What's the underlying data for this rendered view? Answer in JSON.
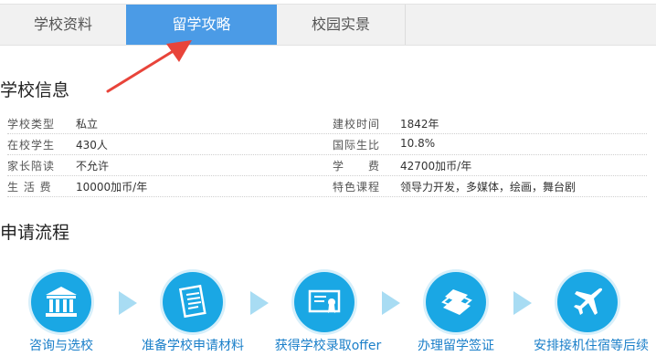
{
  "tabs": [
    {
      "label": "学校资料",
      "active": false
    },
    {
      "label": "留学攻略",
      "active": true
    },
    {
      "label": "校园实景",
      "active": false
    }
  ],
  "school_info": {
    "title": "学校信息",
    "rows": [
      {
        "l1": "学校类型",
        "v1": "私立",
        "l2": "建校时间",
        "v2": "1842年"
      },
      {
        "l1": "在校学生",
        "v1": "430人",
        "l2": "国际生比",
        "v2": "10.8%"
      },
      {
        "l1": "家长陪读",
        "v1": "不允许",
        "l2": "学　　费",
        "v2": "42700加币/年"
      },
      {
        "l1": "生 活 费",
        "v1": "10000加币/年",
        "l2": "特色课程",
        "v2": "领导力开发，多媒体，绘画，舞台剧"
      }
    ]
  },
  "process": {
    "title": "申请流程",
    "steps": [
      {
        "label": "咨询与选校",
        "icon": "institution-icon"
      },
      {
        "label": "准备学校申请材料",
        "icon": "document-icon"
      },
      {
        "label": "获得学校录取offer",
        "icon": "certificate-icon"
      },
      {
        "label": "办理留学签证",
        "icon": "books-icon"
      },
      {
        "label": "安排接机住宿等后续",
        "icon": "airplane-icon"
      }
    ]
  },
  "colors": {
    "accent": "#4b9be6",
    "step_circle": "#1aa7e4",
    "arrow": "#e8443a"
  }
}
